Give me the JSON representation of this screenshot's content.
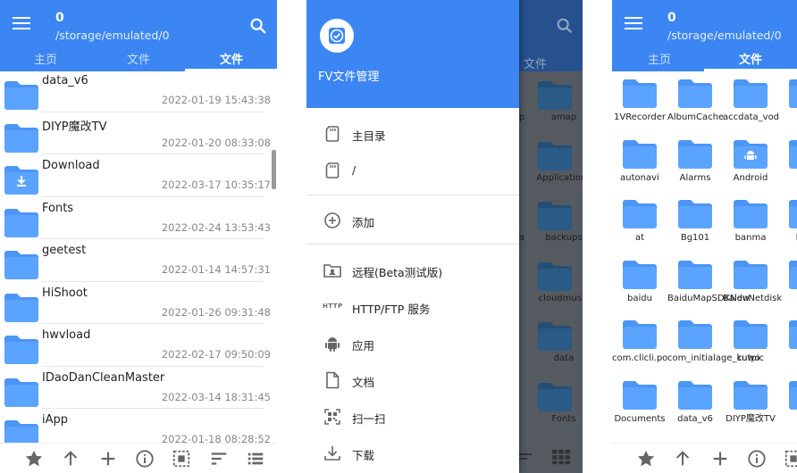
{
  "colors": {
    "accent": "#3b86f2",
    "folder": "#5aa4ff",
    "folder_tab": "#4b95f5",
    "dark_folder": "#2a5a86",
    "date_gray": "#888888"
  },
  "left_panel": {
    "title": "0",
    "path": "/storage/emulated/0",
    "tabs": [
      "主页",
      "文件",
      "文件"
    ],
    "active_tab": 2,
    "rows": [
      {
        "name": "data_v6",
        "date": "2022-01-19 15:43:38",
        "icon": "folder-icon"
      },
      {
        "name": "DIYP魔改TV",
        "date": "2022-01-20 08:33:08",
        "icon": "folder-icon"
      },
      {
        "name": "Download",
        "date": "2022-03-17 10:35:17",
        "icon": "download-folder-icon"
      },
      {
        "name": "Fonts",
        "date": "2022-02-24 13:53:43",
        "icon": "folder-icon"
      },
      {
        "name": "geetest",
        "date": "2022-01-14 14:57:31",
        "icon": "folder-icon"
      },
      {
        "name": "HiShoot",
        "date": "2022-01-26 09:31:48",
        "icon": "folder-icon"
      },
      {
        "name": "hwvload",
        "date": "2022-02-17 09:50:09",
        "icon": "folder-icon"
      },
      {
        "name": "IDaoDanCleanMaster",
        "date": "2022-03-14 18:31:45",
        "icon": "folder-icon"
      },
      {
        "name": "iApp",
        "date": "2022-01-18 08:28:52",
        "icon": "folder-icon"
      }
    ],
    "bottom_icons": [
      "star-icon",
      "arrow-up-icon",
      "plus-icon",
      "info-icon",
      "select-icon",
      "sort-icon",
      "list-view-icon"
    ]
  },
  "drawer": {
    "app_name": "FV文件管理",
    "items": [
      {
        "label": "主目录",
        "icon": "sd-card-icon"
      },
      {
        "label": "/",
        "icon": "sd-card-icon"
      },
      {
        "label": "添加",
        "icon": "add-circle-icon"
      },
      {
        "label": "远程(Beta测试版)",
        "icon": "remote-folder-icon"
      },
      {
        "label": "HTTP/FTP 服务",
        "icon": "http-icon",
        "icon_text": "HTTP"
      },
      {
        "label": "应用",
        "icon": "android-icon"
      },
      {
        "label": "文档",
        "icon": "document-icon"
      },
      {
        "label": "扫一扫",
        "icon": "scan-icon"
      },
      {
        "label": "下载",
        "icon": "download-icon"
      }
    ],
    "behind": {
      "tab_label": "文件",
      "folders": [
        "amap",
        "Applications",
        "backups",
        "cloudmusic",
        "data",
        "Fonts"
      ],
      "partial_letters": [
        "p",
        "",
        "a",
        "",
        "",
        ""
      ]
    }
  },
  "right_panel": {
    "title": "0",
    "path": "/storage/emulated/0",
    "tabs": [
      "主页",
      "文件"
    ],
    "active_tab": 1,
    "grid": [
      [
        "1VRecorder",
        "AlbumCache",
        "accdata_vod",
        "accr"
      ],
      [
        "autonavi",
        "Alarms",
        "Android",
        "An"
      ],
      [
        "at",
        "Bg101",
        "banma",
        "Byte"
      ],
      [
        "baidu",
        "BaiduMapSDKNew",
        "BaiduNetdisk",
        "Bi"
      ],
      [
        "com.clicli.po",
        "com_initialage_kuwo",
        "cutpic",
        "D"
      ],
      [
        "Documents",
        "data_v6",
        "DIYP魔改TV",
        "Dov"
      ]
    ],
    "grid_badges": {
      "1-2": "android",
      "2-3": "download",
      "4-3": "camera",
      "5-3": "download"
    },
    "bottom_icons": [
      "star-icon",
      "arrow-up-icon",
      "plus-icon",
      "info-icon",
      "select-icon"
    ]
  }
}
